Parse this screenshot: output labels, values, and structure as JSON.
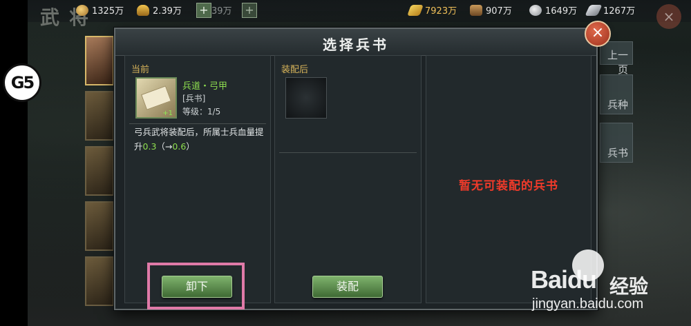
{
  "topbar": {
    "title": "武将",
    "resources": [
      {
        "name": "coin",
        "icon": "coin-icon",
        "value": "1325万"
      },
      {
        "name": "ingot",
        "icon": "gold-ingot-icon",
        "value": "2.39万"
      },
      {
        "name": "extra",
        "value": "39万"
      }
    ],
    "right_resources": [
      {
        "name": "food",
        "icon": "grain-icon",
        "value": "7923万"
      },
      {
        "name": "wood",
        "icon": "wood-icon",
        "value": "907万"
      },
      {
        "name": "stone",
        "icon": "stone-icon",
        "value": "1649万"
      },
      {
        "name": "iron",
        "icon": "iron-icon",
        "value": "1267万"
      }
    ],
    "plus": "+"
  },
  "side_tabs": {
    "prev": "上一页",
    "troops": "兵种",
    "books": "兵书"
  },
  "logo": "G5",
  "dialog": {
    "title": "选择兵书",
    "close": "×",
    "current": {
      "heading": "当前",
      "book_name": "兵道・弓甲",
      "book_type": "[兵书]",
      "level": "等级：1/5",
      "level_badge": "+1",
      "desc_prefix": "弓兵武将装配后，所属士兵血量提升",
      "desc_value": "0.3",
      "desc_mid": "（→",
      "desc_new": "0.6",
      "desc_suffix": "）",
      "button": "卸下"
    },
    "after": {
      "heading": "装配后",
      "button": "装配"
    },
    "empty_text": "暂无可装配的兵书"
  },
  "watermark": {
    "brand": "Baidu",
    "cn": "经验",
    "url": "jingyan.baidu.com"
  }
}
